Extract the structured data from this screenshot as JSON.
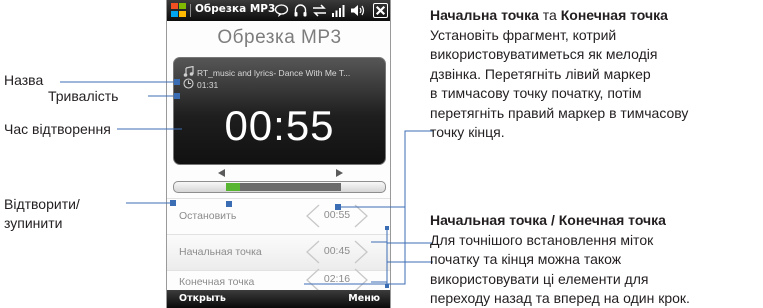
{
  "phone": {
    "window_title": "Обрезка МР3",
    "app_heading": "Обрезка МР3",
    "track_name": "RT_music and lyrics- Dance With Me T...",
    "track_duration": "01:31",
    "playback_time": "00:55",
    "rows": {
      "stop": {
        "label": "Остановить",
        "value": "00:55"
      },
      "start": {
        "label": "Начальная точка",
        "value": "00:45"
      },
      "end": {
        "label": "Конечная точка",
        "value": "02:16"
      }
    },
    "softkeys": {
      "left": "Открыть",
      "right": "Меню"
    },
    "colors": {
      "played": "#58b531",
      "selection": "#6b6b6b"
    }
  },
  "callouts": {
    "name": "Назва",
    "duration": "Тривалість",
    "playback_time": "Час відтворення",
    "play_stop_line1": "Відтворити/",
    "play_stop_line2": "зупинити"
  },
  "descriptions": {
    "markers": {
      "heading_start": "Начальна точка",
      "heading_connector": " та ",
      "heading_end": "Конечная точка",
      "lines": [
        "Установіть фрагмент, котрий",
        "використовуватиметься як мелодія",
        "дзвінка. Перетягніть лівий маркер",
        "в тимчасову точку початку, потім",
        "перетягніть правий маркер в тимчасову",
        "точку кінця."
      ]
    },
    "steppers": {
      "heading": "Начальная точка / Конечная точка",
      "lines": [
        "Для точнішого встановлення міток",
        "початку та кінця можна також",
        "використовувати ці елементи для",
        "переходу назад та вперед на один крок."
      ]
    }
  }
}
